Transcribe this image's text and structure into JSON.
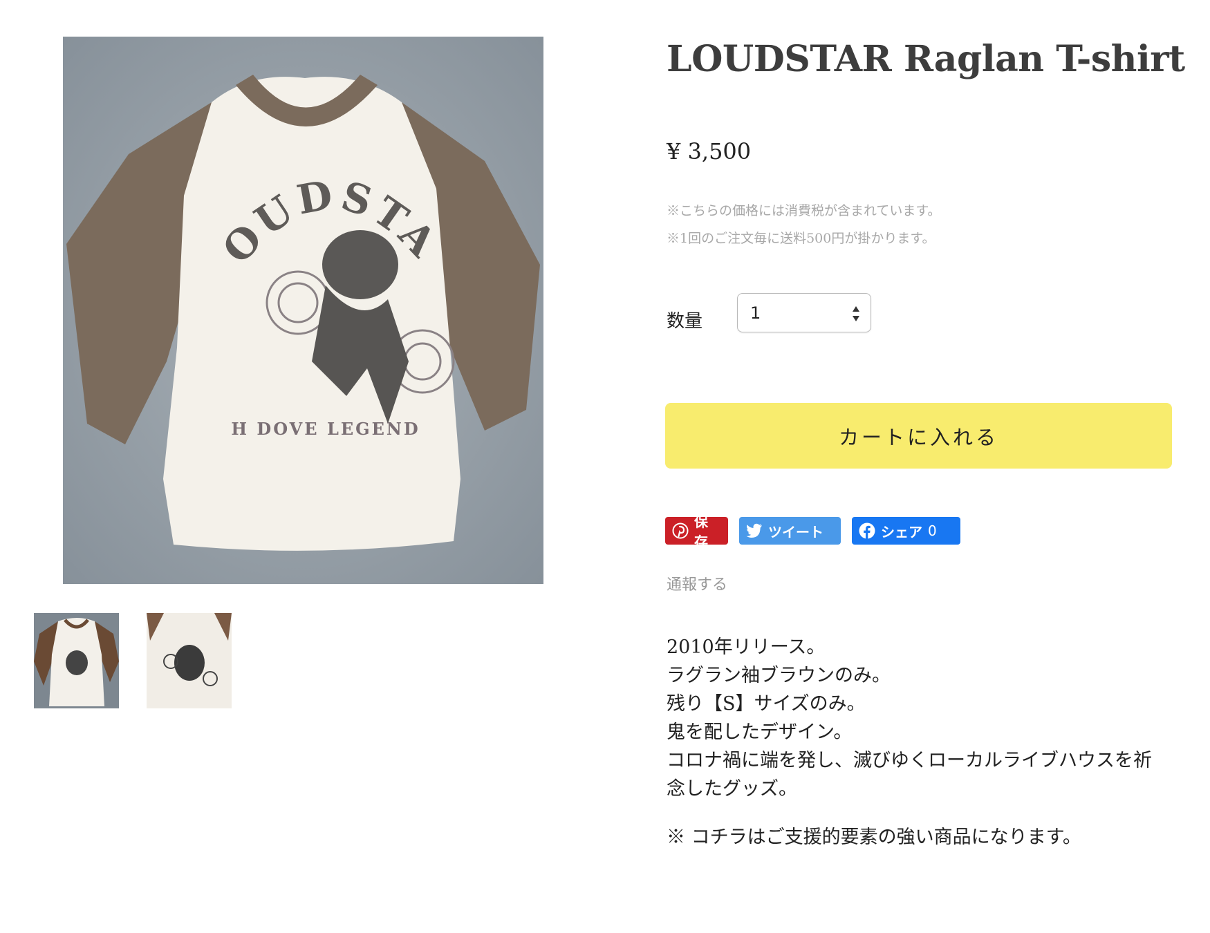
{
  "product": {
    "title": "LOUDSTAR Raglan T-shirt",
    "price": "¥ 3,500",
    "notes": [
      "※こちらの価格には消費税が含まれています。",
      "※1回のご注文毎に送料500円が掛かります。"
    ],
    "quantity_label": "数量",
    "quantity_value": "1",
    "cart_button_label": "カートに入れる",
    "report_label": "通報する",
    "description": [
      "2010年リリース。",
      "ラグラン袖ブラウンのみ。",
      "残り【S】サイズのみ。",
      "鬼を配したデザイン。",
      "コロナ禍に端を発し、滅びゆくローカルライブハウスを祈",
      "念したグッズ。"
    ],
    "description_note": "※ コチラはご支援的要素の強い商品になります。"
  },
  "shirt_print": {
    "arc_text": "LOUDSTAR",
    "bottom_text": "H DOVE LEGEND"
  },
  "share": {
    "pinterest_label": "保存",
    "twitter_label": "ツイート",
    "facebook_label": "シェア",
    "facebook_count": "0"
  },
  "icons": [
    "pinterest-icon",
    "twitter-icon",
    "facebook-icon",
    "select-arrows-icon"
  ],
  "colors": {
    "cart_button": "#f8ec6e",
    "pinterest": "#cb2027",
    "twitter": "#4a99e9",
    "facebook": "#1877f2",
    "shirt_body": "#f4f1ea",
    "shirt_sleeve": "#7b6b5c",
    "background_fabric": "#9aa3aa"
  }
}
